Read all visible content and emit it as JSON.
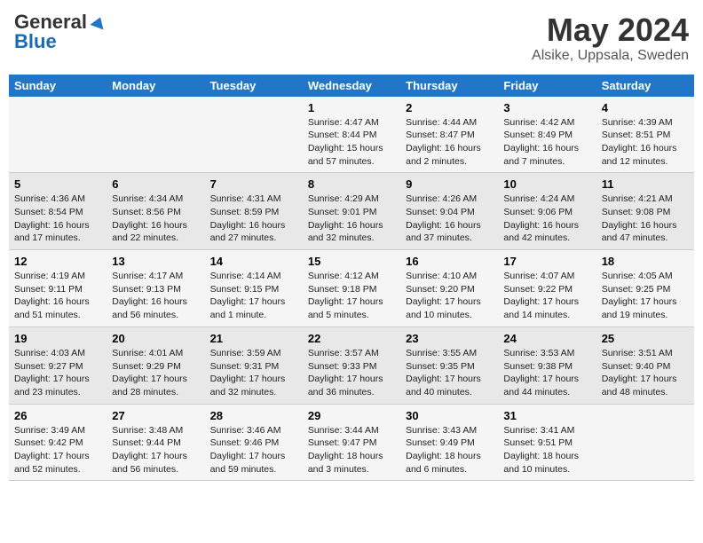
{
  "header": {
    "logo_general": "General",
    "logo_blue": "Blue",
    "month_year": "May 2024",
    "location": "Alsike, Uppsala, Sweden"
  },
  "days_of_week": [
    "Sunday",
    "Monday",
    "Tuesday",
    "Wednesday",
    "Thursday",
    "Friday",
    "Saturday"
  ],
  "weeks": [
    [
      {
        "day": "",
        "content": ""
      },
      {
        "day": "",
        "content": ""
      },
      {
        "day": "",
        "content": ""
      },
      {
        "day": "1",
        "content": "Sunrise: 4:47 AM\nSunset: 8:44 PM\nDaylight: 15 hours and 57 minutes."
      },
      {
        "day": "2",
        "content": "Sunrise: 4:44 AM\nSunset: 8:47 PM\nDaylight: 16 hours and 2 minutes."
      },
      {
        "day": "3",
        "content": "Sunrise: 4:42 AM\nSunset: 8:49 PM\nDaylight: 16 hours and 7 minutes."
      },
      {
        "day": "4",
        "content": "Sunrise: 4:39 AM\nSunset: 8:51 PM\nDaylight: 16 hours and 12 minutes."
      }
    ],
    [
      {
        "day": "5",
        "content": "Sunrise: 4:36 AM\nSunset: 8:54 PM\nDaylight: 16 hours and 17 minutes."
      },
      {
        "day": "6",
        "content": "Sunrise: 4:34 AM\nSunset: 8:56 PM\nDaylight: 16 hours and 22 minutes."
      },
      {
        "day": "7",
        "content": "Sunrise: 4:31 AM\nSunset: 8:59 PM\nDaylight: 16 hours and 27 minutes."
      },
      {
        "day": "8",
        "content": "Sunrise: 4:29 AM\nSunset: 9:01 PM\nDaylight: 16 hours and 32 minutes."
      },
      {
        "day": "9",
        "content": "Sunrise: 4:26 AM\nSunset: 9:04 PM\nDaylight: 16 hours and 37 minutes."
      },
      {
        "day": "10",
        "content": "Sunrise: 4:24 AM\nSunset: 9:06 PM\nDaylight: 16 hours and 42 minutes."
      },
      {
        "day": "11",
        "content": "Sunrise: 4:21 AM\nSunset: 9:08 PM\nDaylight: 16 hours and 47 minutes."
      }
    ],
    [
      {
        "day": "12",
        "content": "Sunrise: 4:19 AM\nSunset: 9:11 PM\nDaylight: 16 hours and 51 minutes."
      },
      {
        "day": "13",
        "content": "Sunrise: 4:17 AM\nSunset: 9:13 PM\nDaylight: 16 hours and 56 minutes."
      },
      {
        "day": "14",
        "content": "Sunrise: 4:14 AM\nSunset: 9:15 PM\nDaylight: 17 hours and 1 minute."
      },
      {
        "day": "15",
        "content": "Sunrise: 4:12 AM\nSunset: 9:18 PM\nDaylight: 17 hours and 5 minutes."
      },
      {
        "day": "16",
        "content": "Sunrise: 4:10 AM\nSunset: 9:20 PM\nDaylight: 17 hours and 10 minutes."
      },
      {
        "day": "17",
        "content": "Sunrise: 4:07 AM\nSunset: 9:22 PM\nDaylight: 17 hours and 14 minutes."
      },
      {
        "day": "18",
        "content": "Sunrise: 4:05 AM\nSunset: 9:25 PM\nDaylight: 17 hours and 19 minutes."
      }
    ],
    [
      {
        "day": "19",
        "content": "Sunrise: 4:03 AM\nSunset: 9:27 PM\nDaylight: 17 hours and 23 minutes."
      },
      {
        "day": "20",
        "content": "Sunrise: 4:01 AM\nSunset: 9:29 PM\nDaylight: 17 hours and 28 minutes."
      },
      {
        "day": "21",
        "content": "Sunrise: 3:59 AM\nSunset: 9:31 PM\nDaylight: 17 hours and 32 minutes."
      },
      {
        "day": "22",
        "content": "Sunrise: 3:57 AM\nSunset: 9:33 PM\nDaylight: 17 hours and 36 minutes."
      },
      {
        "day": "23",
        "content": "Sunrise: 3:55 AM\nSunset: 9:35 PM\nDaylight: 17 hours and 40 minutes."
      },
      {
        "day": "24",
        "content": "Sunrise: 3:53 AM\nSunset: 9:38 PM\nDaylight: 17 hours and 44 minutes."
      },
      {
        "day": "25",
        "content": "Sunrise: 3:51 AM\nSunset: 9:40 PM\nDaylight: 17 hours and 48 minutes."
      }
    ],
    [
      {
        "day": "26",
        "content": "Sunrise: 3:49 AM\nSunset: 9:42 PM\nDaylight: 17 hours and 52 minutes."
      },
      {
        "day": "27",
        "content": "Sunrise: 3:48 AM\nSunset: 9:44 PM\nDaylight: 17 hours and 56 minutes."
      },
      {
        "day": "28",
        "content": "Sunrise: 3:46 AM\nSunset: 9:46 PM\nDaylight: 17 hours and 59 minutes."
      },
      {
        "day": "29",
        "content": "Sunrise: 3:44 AM\nSunset: 9:47 PM\nDaylight: 18 hours and 3 minutes."
      },
      {
        "day": "30",
        "content": "Sunrise: 3:43 AM\nSunset: 9:49 PM\nDaylight: 18 hours and 6 minutes."
      },
      {
        "day": "31",
        "content": "Sunrise: 3:41 AM\nSunset: 9:51 PM\nDaylight: 18 hours and 10 minutes."
      },
      {
        "day": "",
        "content": ""
      }
    ]
  ]
}
